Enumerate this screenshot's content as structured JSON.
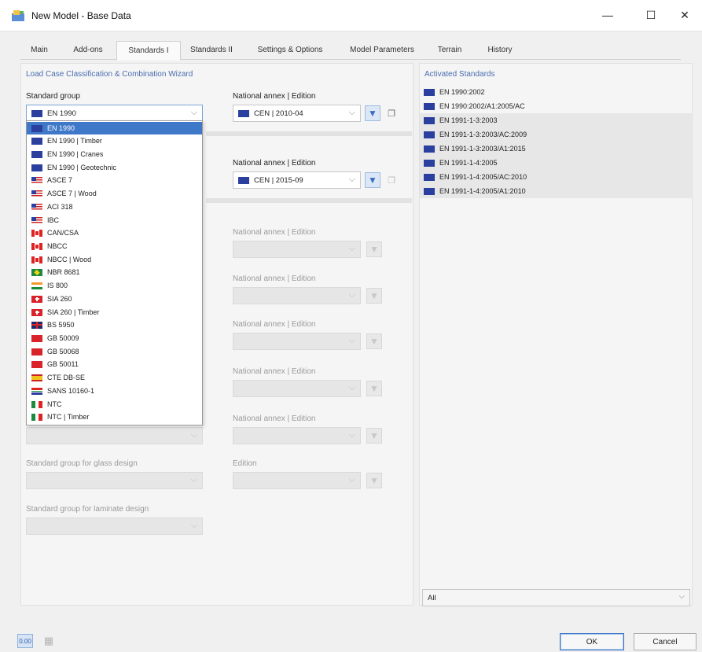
{
  "window": {
    "title": "New Model - Base Data",
    "min_glyph": "—",
    "max_glyph": "☐",
    "close_glyph": "✕"
  },
  "tabs": [
    {
      "label": "Main"
    },
    {
      "label": "Add-ons"
    },
    {
      "label": "Standards I"
    },
    {
      "label": "Standards II"
    },
    {
      "label": "Settings & Options"
    },
    {
      "label": "Model Parameters"
    },
    {
      "label": "Terrain"
    },
    {
      "label": "History"
    }
  ],
  "left": {
    "section_title": "Load Case Classification & Combination Wizard",
    "standard_group_label": "Standard group",
    "standard_group_value": "EN 1990",
    "national_annex_label": "National annex | Edition",
    "annex_1_value": "CEN | 2010-04",
    "annex_2_label": "National annex | Edition",
    "annex_2_value": "CEN | 2015-09",
    "dim_annex_labels": [
      "National annex | Edition",
      "National annex | Edition",
      "National annex | Edition",
      "National annex | Edition",
      "National annex | Edition"
    ],
    "glass_label": "Standard group for glass design",
    "glass_edition_label": "Edition",
    "laminate_label": "Standard group for laminate design"
  },
  "dropdown": {
    "items": [
      {
        "label": "EN 1990",
        "flag": "eu"
      },
      {
        "label": "EN 1990 | Timber",
        "flag": "eu"
      },
      {
        "label": "EN 1990 | Cranes",
        "flag": "eu"
      },
      {
        "label": "EN 1990 | Geotechnic",
        "flag": "eu"
      },
      {
        "label": "ASCE 7",
        "flag": "us"
      },
      {
        "label": "ASCE 7 | Wood",
        "flag": "us"
      },
      {
        "label": "ACI 318",
        "flag": "us"
      },
      {
        "label": "IBC",
        "flag": "us"
      },
      {
        "label": "CAN/CSA",
        "flag": "ca"
      },
      {
        "label": "NBCC",
        "flag": "ca"
      },
      {
        "label": "NBCC | Wood",
        "flag": "ca"
      },
      {
        "label": "NBR 8681",
        "flag": "br"
      },
      {
        "label": "IS 800",
        "flag": "in"
      },
      {
        "label": "SIA 260",
        "flag": "ch"
      },
      {
        "label": "SIA 260 | Timber",
        "flag": "ch"
      },
      {
        "label": "BS 5950",
        "flag": "gb"
      },
      {
        "label": "GB 50009",
        "flag": "cn"
      },
      {
        "label": "GB 50068",
        "flag": "cn"
      },
      {
        "label": "GB 50011",
        "flag": "cn"
      },
      {
        "label": "CTE DB-SE",
        "flag": "es"
      },
      {
        "label": "SANS 10160-1",
        "flag": "za"
      },
      {
        "label": "NTC",
        "flag": "it"
      },
      {
        "label": "NTC | Timber",
        "flag": "it"
      }
    ],
    "selected_index": 0
  },
  "right": {
    "title": "Activated Standards",
    "items": [
      "EN 1990:2002",
      "EN 1990:2002/A1:2005/AC",
      "EN 1991-1-3:2003",
      "EN 1991-1-3:2003/AC:2009",
      "EN 1991-1-3:2003/A1:2015",
      "EN 1991-1-4:2005",
      "EN 1991-1-4:2005/AC:2010",
      "EN 1991-1-4:2005/A1:2010"
    ],
    "filter_value": "All"
  },
  "footer": {
    "ok_label": "OK",
    "cancel_label": "Cancel",
    "icon1_text": "0.00"
  }
}
